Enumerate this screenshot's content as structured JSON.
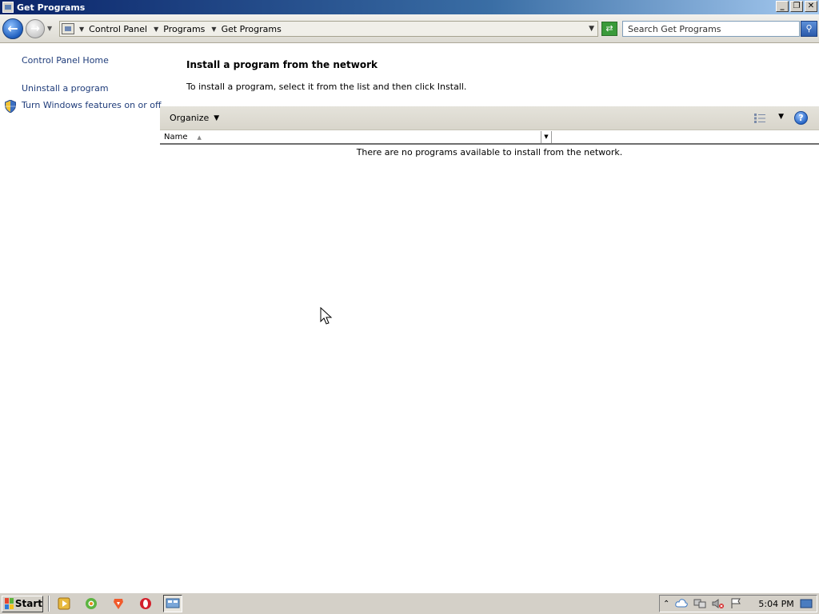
{
  "window": {
    "title": "Get Programs",
    "buttons": {
      "minimize": "_",
      "restore": "❐",
      "close": "✕"
    }
  },
  "address": {
    "crumbs": [
      "Control Panel",
      "Programs",
      "Get Programs"
    ],
    "search_placeholder": "Search Get Programs"
  },
  "sidebar": {
    "home": "Control Panel Home",
    "uninstall": "Uninstall a program",
    "features": "Turn Windows features on or off"
  },
  "main": {
    "heading": "Install a program from the network",
    "instructions": "To install a program, select it from the list and then click Install.",
    "organize_label": "Organize",
    "column_name": "Name",
    "empty_message": "There are no programs available to install from the network."
  },
  "taskbar": {
    "start_label": "Start",
    "clock": "5:04 PM"
  },
  "colors": {
    "titlebar": "#0a246a",
    "link": "#1f3c7a",
    "toolbar": "#e5e3db"
  }
}
